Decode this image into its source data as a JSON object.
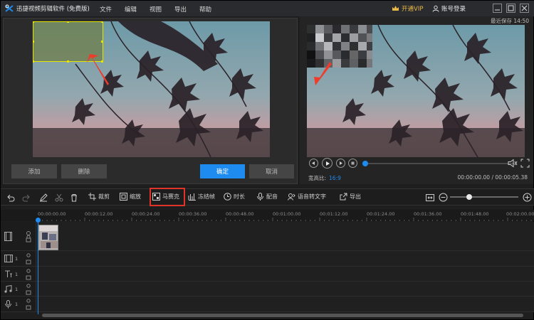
{
  "app": {
    "title": "迅捷视频剪辑软件 (免费版)",
    "menu": [
      "文件",
      "编辑",
      "视图",
      "导出",
      "帮助"
    ],
    "vip_label": "开通VIP",
    "login_label": "账号登录"
  },
  "editor": {
    "add_label": "添加",
    "delete_label": "删除",
    "confirm_label": "确定",
    "cancel_label": "取消"
  },
  "preview": {
    "save_note": "最近保存 14:50",
    "aspect_label": "宽高比:",
    "aspect_value": "16:9",
    "timecode": "00:00:00.00 / 00:00:05.38",
    "progress": 0.02
  },
  "toolbar": {
    "crop_label": "裁剪",
    "zoom_label": "缩放",
    "mosaic_label": "马赛克",
    "freeze_label": "冻结帧",
    "duration_label": "时长",
    "dub_label": "配音",
    "speech_label": "语音转文字",
    "export_label": "导出",
    "zoom_level": 0.28
  },
  "timeline": {
    "ticks": [
      "00:00:00.00",
      "00:00:12.00",
      "00:00:24.00",
      "00:00:36.00",
      "00:00:48.00",
      "00:01:00.00",
      "00:01:12.00",
      "00:01:24.00",
      "00:01:36.00",
      "00:01:48.00",
      "00:02:00.00"
    ],
    "tracks": [
      {
        "icon": "video-track-icon",
        "num": ""
      },
      {
        "icon": "film-track-icon",
        "num": "1"
      },
      {
        "icon": "text-track-icon",
        "num": "1"
      },
      {
        "icon": "music-track-icon",
        "num": "1"
      },
      {
        "icon": "mic-track-icon",
        "num": "1"
      }
    ]
  },
  "colors": {
    "accent": "#1e8bf0",
    "highlight": "#e0342b",
    "selection": "#e6e600",
    "vip": "#e9b949"
  }
}
